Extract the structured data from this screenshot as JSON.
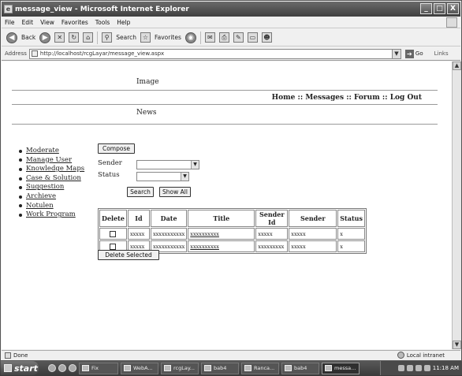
{
  "window": {
    "title": "message_view - Microsoft Internet Explorer",
    "minimize": "_",
    "maximize": "□",
    "close": "X"
  },
  "menubar": [
    "File",
    "Edit",
    "View",
    "Favorites",
    "Tools",
    "Help"
  ],
  "toolbar": {
    "back_label": "Back",
    "search_label": "Search",
    "favorites_label": "Favorites"
  },
  "address": {
    "label": "Address",
    "url": "http://localhost/rcgLayar/message_view.aspx",
    "go_label": "Go",
    "links_label": "Links"
  },
  "page": {
    "image_label": "Image",
    "nav": {
      "home": "Home",
      "messages": "Messages",
      "forum": "Forum",
      "logout": "Log Out",
      "separator": "::"
    },
    "news_label": "News",
    "side_menu": [
      "Moderate",
      "Manage User",
      "Knowledge Maps",
      "Case & Solution",
      "Suggestion",
      "Archieve",
      "Notulen",
      "Work Program"
    ],
    "compose_label": "Compose",
    "sender_label": "Sender",
    "status_label": "Status",
    "sender_value": "",
    "status_value": "",
    "search_label": "Search",
    "show_all_label": "Show All",
    "table": {
      "headers": [
        "Delete",
        "Id",
        "Date",
        "Title",
        "Sender Id",
        "Sender",
        "Status"
      ],
      "rows": [
        {
          "id": "xxxxx",
          "date": "xxxxxxxxxxx",
          "title": "xxxxxxxxxx",
          "sender_id": "xxxxx",
          "sender": "xxxxx",
          "status": "x"
        },
        {
          "id": "xxxxx",
          "date": "xxxxxxxxxxx",
          "title": "xxxxxxxxxx",
          "sender_id": "xxxxxxxxx",
          "sender": "xxxxx",
          "status": "x"
        }
      ]
    },
    "delete_selected_label": "Delete Selected"
  },
  "statusbar": {
    "status": "Done",
    "zone": "Local intranet"
  },
  "taskbar": {
    "start_label": "start",
    "tasks": [
      "Fix",
      "WebA...",
      "rcgLay...",
      "bab4",
      "Ranca...",
      "bab4",
      "messa..."
    ],
    "clock": "11:18 AM"
  }
}
